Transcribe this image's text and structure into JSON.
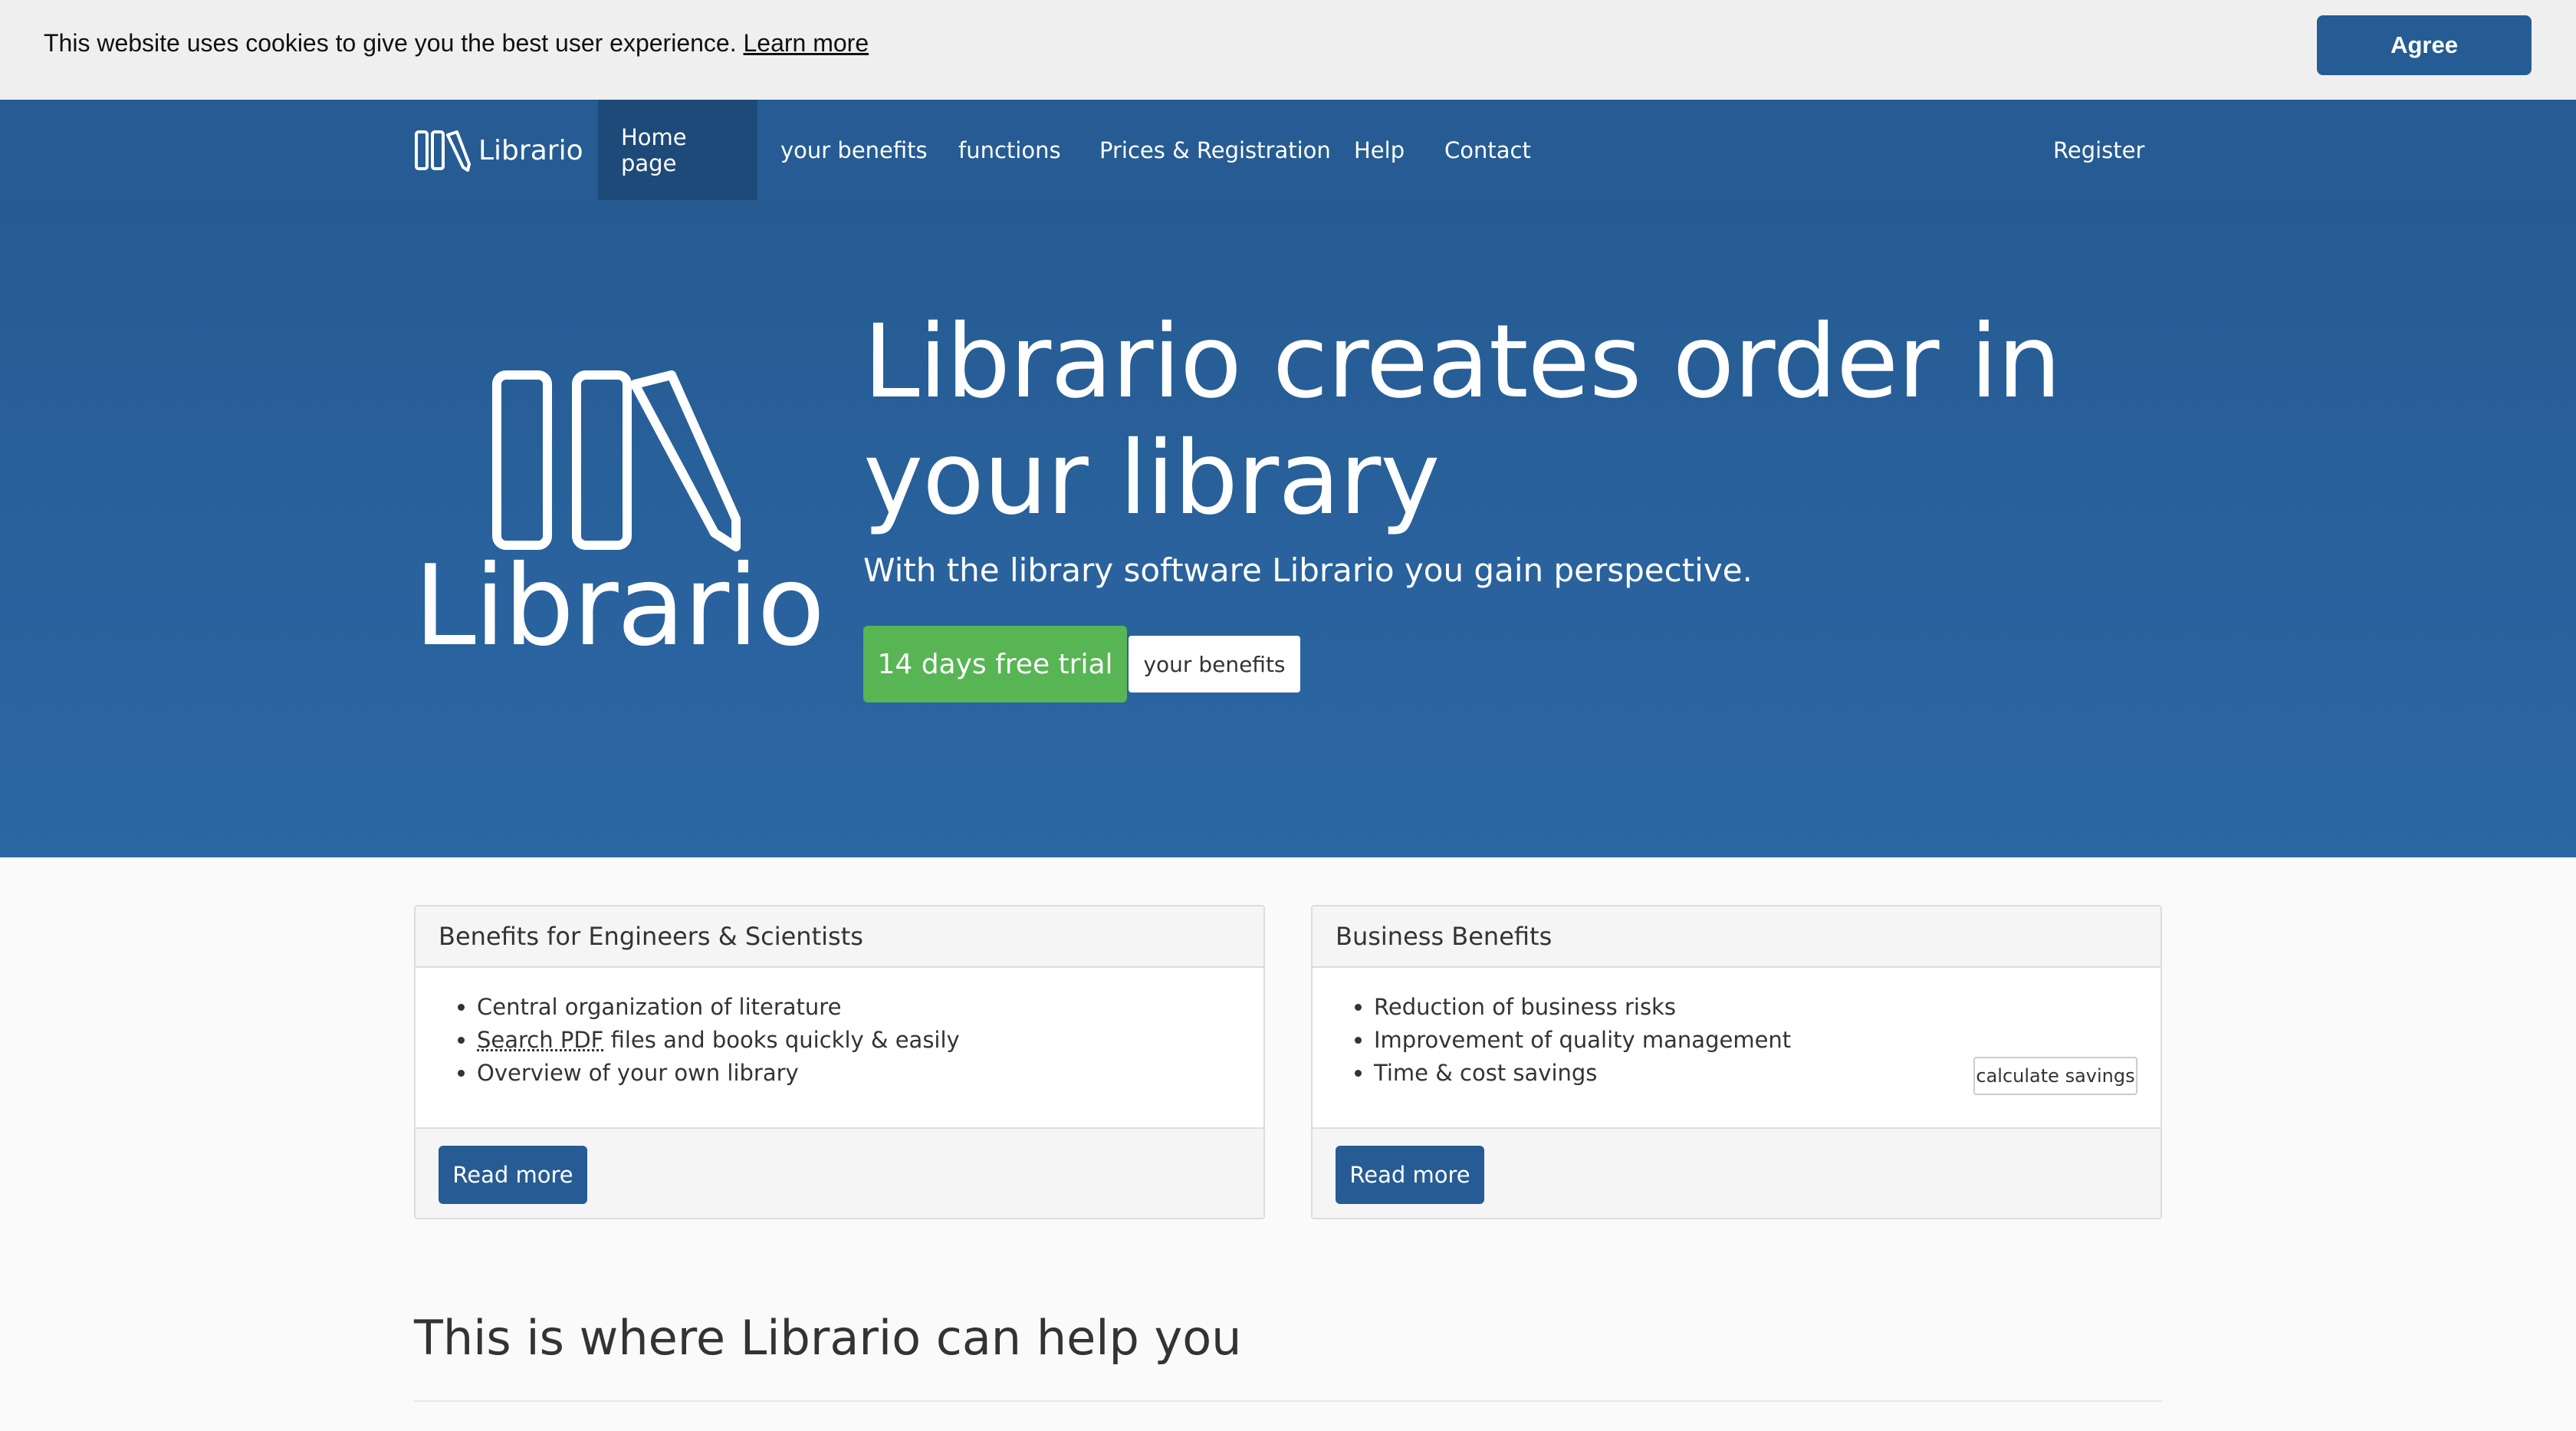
{
  "cookie": {
    "text": "This website uses cookies to give you the best user experience.",
    "link": "Learn more",
    "agree": "Agree"
  },
  "nav": {
    "brand": "Librario",
    "items": [
      "Home page",
      "your benefits",
      "functions",
      "Prices & Registration",
      "Help",
      "Contact"
    ],
    "register": "Register"
  },
  "hero": {
    "logo_text": "Librario",
    "title_line1": "Librario creates order in",
    "title_line2": "your library",
    "subtitle": "With the library software Librario you gain perspective.",
    "trial": "14 days free trial",
    "benefits": "your benefits"
  },
  "cards": {
    "engineers": {
      "title": "Benefits for Engineers & Scientists",
      "item1": "Central organization of literature",
      "item2_abbr": "Search PDF",
      "item2_rest": " files and books quickly & easily",
      "item3": "Overview of your own library",
      "read_more": "Read more"
    },
    "business": {
      "title": "Business Benefits",
      "items": [
        "Reduction of business risks",
        "Improvement of quality management",
        "Time & cost savings"
      ],
      "calc": "calculate savings",
      "read_more": "Read more"
    }
  },
  "section": {
    "title": "This is where Librario can help you"
  },
  "colors": {
    "brand_blue": "#265c93",
    "active_nav": "#1d4a78",
    "trial_green": "#58b554"
  }
}
